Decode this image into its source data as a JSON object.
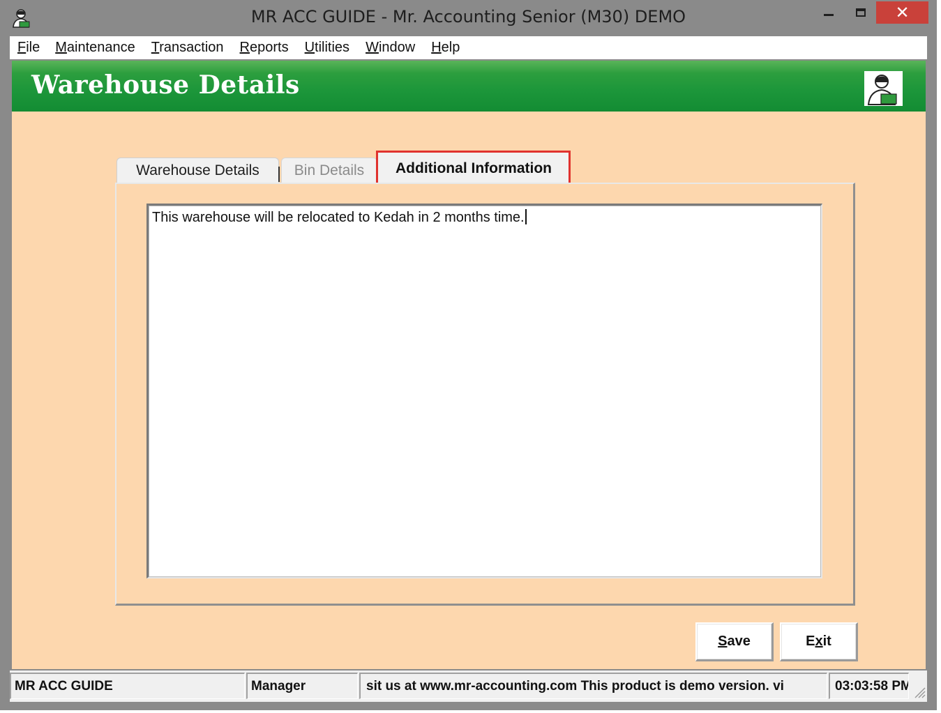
{
  "window": {
    "title": "MR ACC GUIDE - Mr. Accounting Senior (M30) DEMO",
    "app_icon": "accountant-logo-icon",
    "controls": {
      "minimize_icon": "minimize-icon",
      "maximize_icon": "maximize-icon",
      "close_glyph": "✕"
    }
  },
  "menu": {
    "items": [
      {
        "accel": "F",
        "rest": "ile"
      },
      {
        "accel": "M",
        "rest": "aintenance"
      },
      {
        "accel": "T",
        "rest": "ransaction"
      },
      {
        "accel": "R",
        "rest": "eports"
      },
      {
        "accel": "U",
        "rest": "tilities"
      },
      {
        "accel": "W",
        "rest": "indow"
      },
      {
        "accel": "H",
        "rest": "elp"
      }
    ]
  },
  "header": {
    "title": "Warehouse Details",
    "icon": "accountant-logo-icon",
    "colors": {
      "band": "#1c963a",
      "text": "#ffffff"
    }
  },
  "tabs": [
    {
      "label": "Warehouse Details",
      "state": "inactive"
    },
    {
      "label": "Bin Details",
      "state": "disabled"
    },
    {
      "label": "Additional Information",
      "state": "active",
      "highlighted": true
    }
  ],
  "additional_info": {
    "text": "This warehouse will be relocated to Kedah in 2 months time."
  },
  "buttons": {
    "save": {
      "accel": "S",
      "rest": "ave"
    },
    "exit": {
      "pre": "E",
      "accel": "x",
      "rest": "it"
    }
  },
  "status": {
    "company": "MR ACC GUIDE",
    "user": "Manager",
    "message": "sit us at www.mr-accounting.com This product is demo version.  vi",
    "time": "03:03:58 PM"
  },
  "colors": {
    "client_bg": "#fdd7ae",
    "highlight": "#e0322e",
    "close_button": "#c9413a"
  }
}
